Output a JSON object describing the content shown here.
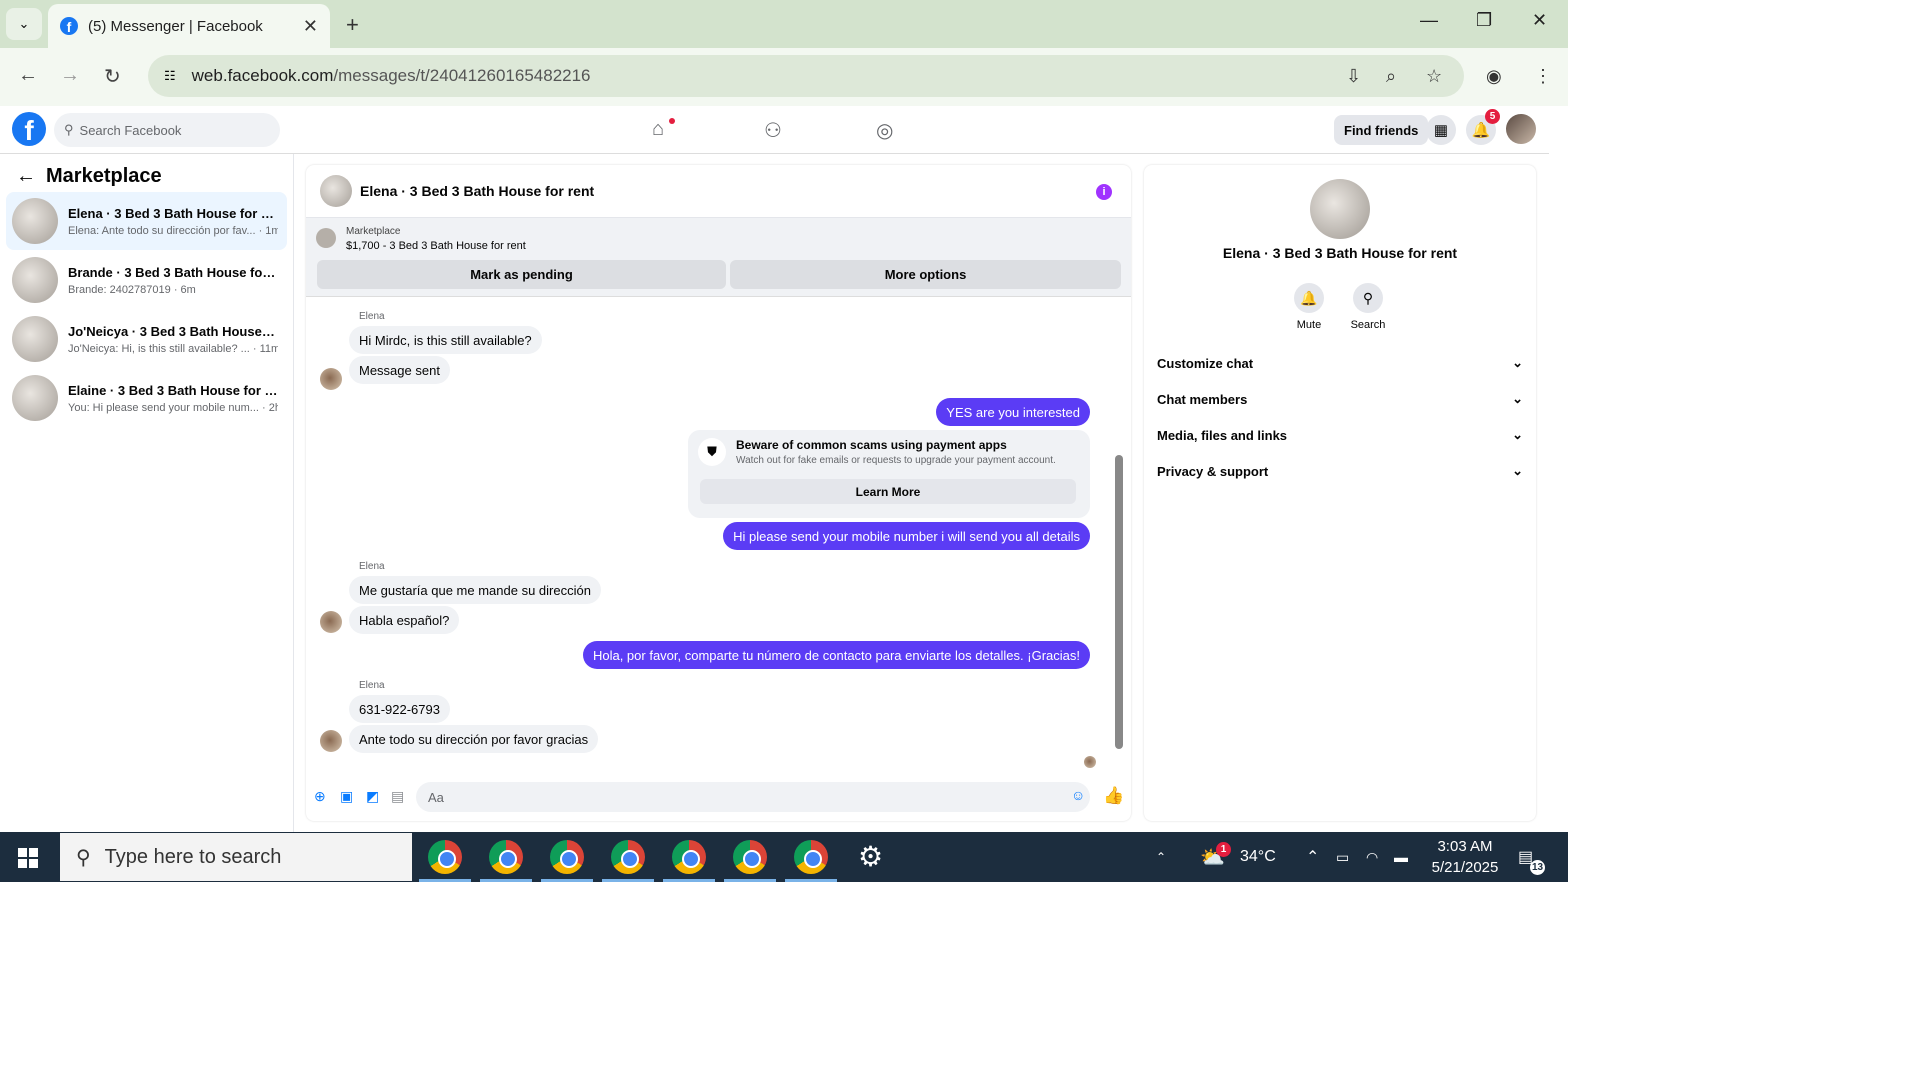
{
  "browser": {
    "tab_title": "(5) Messenger | Facebook",
    "url_host": "web.facebook.com",
    "url_path": "/messages/t/24041260165482216"
  },
  "facebook": {
    "search_placeholder": "Search Facebook",
    "find_friends": "Find friends",
    "notification_count": "5"
  },
  "sidebar": {
    "title": "Marketplace",
    "conversations": [
      {
        "name": "Elena · 3 Bed 3 Bath House for rent",
        "preview": "Elena: Ante todo su dirección por fav... · 1m"
      },
      {
        "name": "Brande · 3 Bed 3 Bath House for re...",
        "preview": "Brande: 2402787019 · 6m"
      },
      {
        "name": "Jo'Neicya · 3 Bed 3 Bath House for...",
        "preview": "Jo'Neicya: Hi, is this still available? ... · 11m"
      },
      {
        "name": "Elaine · 3 Bed 3 Bath House for rent",
        "preview": "You: Hi please send your mobile num... · 2h"
      }
    ]
  },
  "chat": {
    "title": "Elena · 3 Bed 3 Bath House for rent",
    "marketplace_label": "Marketplace",
    "listing": "$1,700 - 3 Bed 3 Bath House for rent",
    "btn_pending": "Mark as pending",
    "btn_more": "More options",
    "sender": "Elena",
    "messages": {
      "m1": "Hi Mirdc, is this still available?",
      "m2": "Message sent",
      "m3": "YES are you interested",
      "m4": "Hi please send your mobile number  i will send you all details",
      "m5": "Me gustaría que me mande su dirección",
      "m6": "Habla español?",
      "m7": "Hola, por favor, comparte tu número de contacto para enviarte los detalles. ¡Gracias!",
      "m8": "631-922-6793",
      "m9": "Ante todo su dirección por favor gracias"
    },
    "scam_title": "Beware of common scams using payment apps",
    "scam_text": "Watch out for fake emails or requests to upgrade your payment account.",
    "learn_more": "Learn More",
    "composer_placeholder": "Aa"
  },
  "details": {
    "name": "Elena · 3 Bed 3 Bath House for rent",
    "mute": "Mute",
    "search": "Search",
    "sections": [
      "Customize chat",
      "Chat members",
      "Media, files and links",
      "Privacy & support"
    ]
  },
  "taskbar": {
    "search_placeholder": "Type here to search",
    "weather": "34°C",
    "weather_badge": "1",
    "time": "3:03 AM",
    "date": "5/21/2025",
    "notif_count": "13"
  },
  "colors": {
    "accent": "#5b3cf5",
    "facebook_blue": "#1877f2",
    "tabbar": "#d3e3cd"
  }
}
